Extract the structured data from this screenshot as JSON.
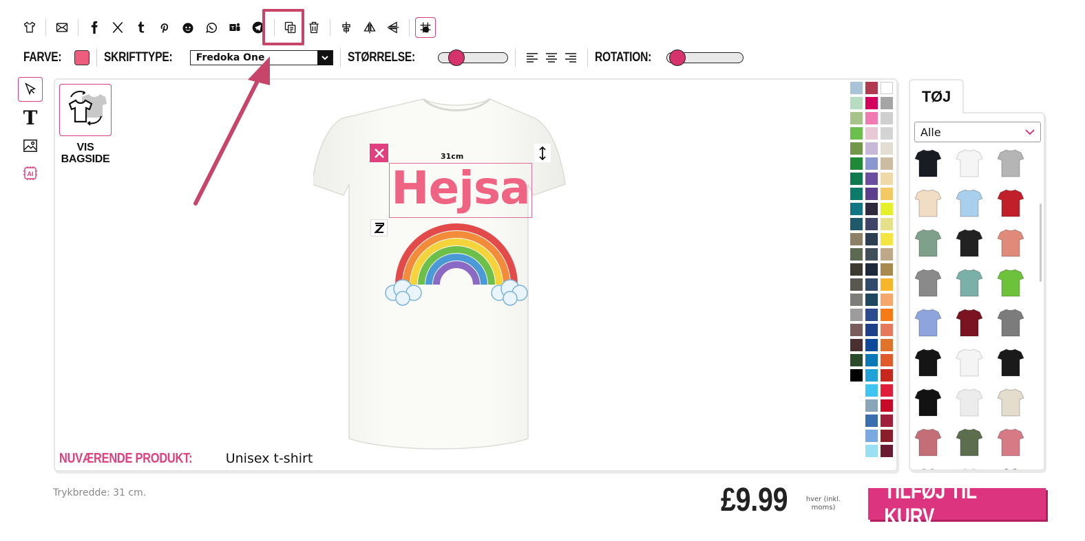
{
  "toolbar": {
    "icons": [
      "tshirt-icon",
      "mail-icon",
      "facebook-icon",
      "x-icon",
      "tumblr-icon",
      "pinterest-icon",
      "reddit-icon",
      "whatsapp-icon",
      "teams-icon",
      "telegram-icon",
      "duplicate-icon",
      "delete-icon",
      "center-icon",
      "flip-horizontal-icon",
      "flip-vertical-icon",
      "grid-icon"
    ]
  },
  "options": {
    "color_label": "FARVE:",
    "color_value": "#ee5c7e",
    "font_label": "SKRIFTTYPE:",
    "font_value": "Fredoka One",
    "size_label": "STØRRELSE:",
    "size_level": 0.17,
    "rotation_label": "ROTATION:",
    "rotation_level": 0.05
  },
  "left_tools": [
    "pointer-icon",
    "text-icon",
    "image-icon",
    "ai-icon"
  ],
  "canvas": {
    "view_back_label_1": "VIS",
    "view_back_label_2": "BAGSIDE",
    "text_element": "Hejsa",
    "text_color": "#ef6483",
    "size_label": "31cm",
    "current_product_key": "NUVÆRENDE PRODUKT:",
    "current_product_value": "Unisex t-shirt"
  },
  "colors": [
    "#a9c4d6",
    "#b03a51",
    "#ffffff",
    "#b6dcc2",
    "#d4005e",
    "#a5a5a5",
    "#a6c48a",
    "#f27ab2",
    "#cfcfcf",
    "#6cbf4e",
    "#e8c8d4",
    "#d4d4d4",
    "#72974a",
    "#c8b8d8",
    "#e3ddd3",
    "#1e8a36",
    "#8a98cf",
    "#cdbca1",
    "#0f7a4d",
    "#6a4fa0",
    "#efd9a8",
    "#0e7a6a",
    "#5b3f8c",
    "#f3c964",
    "#117584",
    "#2e2a3c",
    "#e6f02a",
    "#1e5a6a",
    "#404466",
    "#e6e08a",
    "#8c8066",
    "#2e3e52",
    "#f5e542",
    "#5c6a52",
    "#3f4e58",
    "#bfa88a",
    "#3d3a32",
    "#1e2a3a",
    "#a8894e",
    "#595850",
    "#2f4a6a",
    "#f7b52a",
    "#7d7d7a",
    "#1f4860",
    "#f6a86c",
    "#9c9c9c",
    "#2d4a8e",
    "#f67b16",
    "#7a5c5c",
    "#1f3f8a",
    "#e6785c",
    "#4a3030",
    "#0d4a9a",
    "#e0732a",
    "#2a4a2a",
    "#0c78b8",
    "#e05a2a",
    "#000000",
    "#22a0d8",
    "#c6281e",
    null,
    "#40c4f0",
    "#e01e3c",
    null,
    "#8aa4b8",
    "#c80a2a",
    null,
    "#3a6eae",
    "#a01e3c",
    null,
    "#7aa8e0",
    "#8a1e2a",
    null,
    "#9ae0f4",
    "#6a1a32"
  ],
  "panel": {
    "tab_label": "TØJ",
    "category_value": "Alle",
    "products": [
      {
        "name": "tshirt-black",
        "color": "#1a1c24"
      },
      {
        "name": "raglan-white-black",
        "color": "#f5f5f5"
      },
      {
        "name": "hoodie-grey",
        "color": "#b5b5b5"
      },
      {
        "name": "tshirt-cream",
        "color": "#f1dcc4"
      },
      {
        "name": "tshirt-lightblue",
        "color": "#a8d0ec"
      },
      {
        "name": "varsity-red",
        "color": "#c0202a"
      },
      {
        "name": "longsleeve-green",
        "color": "#7fa08a"
      },
      {
        "name": "hoodie-black-orange",
        "color": "#222222"
      },
      {
        "name": "tank-salmon",
        "color": "#e08a7a"
      },
      {
        "name": "crop-grey",
        "color": "#8a8a8a"
      },
      {
        "name": "hoodie-dyed",
        "color": "#7ab0a8"
      },
      {
        "name": "polo-green",
        "color": "#6cc23a"
      },
      {
        "name": "vneck-blue",
        "color": "#8ea4dc"
      },
      {
        "name": "longsleeve-maroon",
        "color": "#7a1420"
      },
      {
        "name": "tshirt-grey",
        "color": "#7c7c7c"
      },
      {
        "name": "tshirt-black-2",
        "color": "#151515"
      },
      {
        "name": "tshirt-white",
        "color": "#f4f4f4"
      },
      {
        "name": "tank-black",
        "color": "#1a1a1a"
      },
      {
        "name": "tshirt-black-women",
        "color": "#121212"
      },
      {
        "name": "dress-white",
        "color": "#ececec"
      },
      {
        "name": "cardigan-beige",
        "color": "#e4dccc"
      },
      {
        "name": "longsleeve-pink",
        "color": "#c46e78"
      },
      {
        "name": "crop-tank-green",
        "color": "#5c6e4e"
      },
      {
        "name": "tank-pink",
        "color": "#d67a86"
      },
      {
        "name": "item-pink",
        "color": "#e8c0c8"
      },
      {
        "name": "item-white",
        "color": "#f0f0f0"
      },
      {
        "name": "item-brown",
        "color": "#8a6a4a"
      }
    ]
  },
  "bottom": {
    "print_width": "Trykbredde: 31 cm.",
    "price": "£9.99",
    "price_note_1": "hver (inkl.",
    "price_note_2": "moms)",
    "add_to_cart": "TILFØJ TIL KURV"
  },
  "accent_color": "#dd3480",
  "annotation_color": "#c7456b"
}
